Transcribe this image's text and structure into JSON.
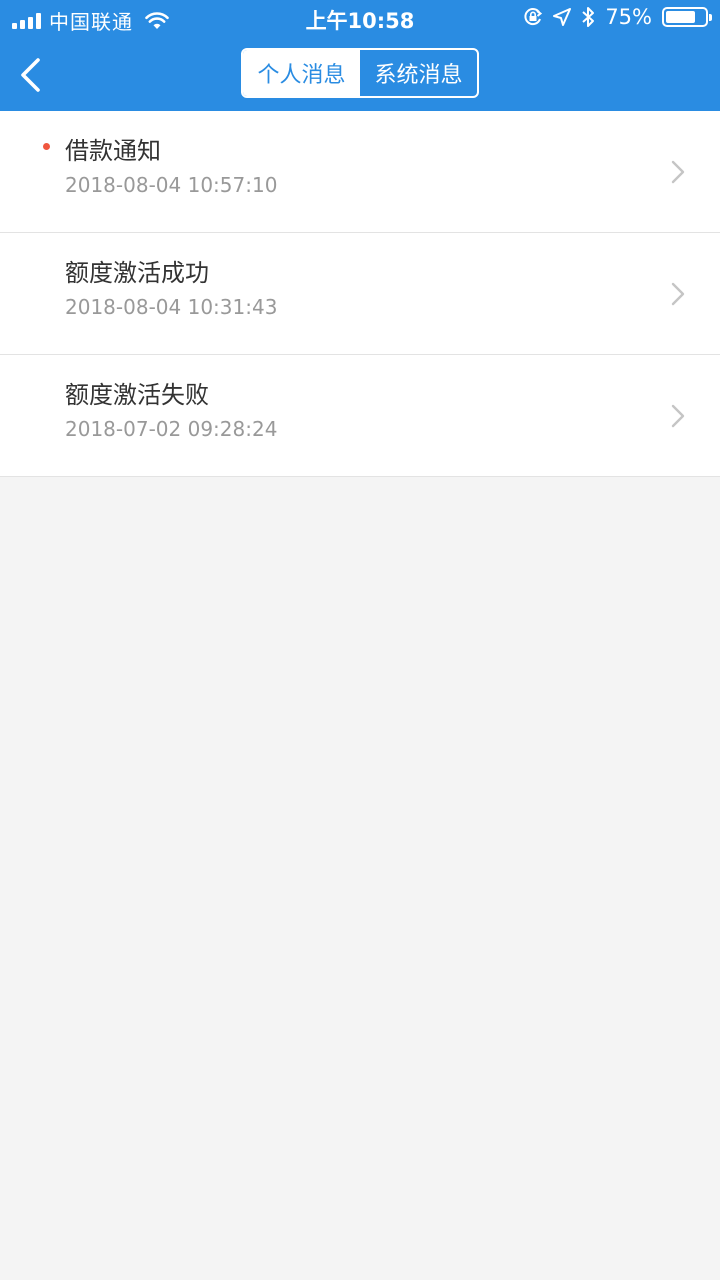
{
  "status_bar": {
    "carrier": "中国联通",
    "time": "上午10:58",
    "battery_percent": "75%",
    "battery_level": 0.75
  },
  "nav": {
    "tabs": [
      {
        "label": "个人消息",
        "active": true
      },
      {
        "label": "系统消息",
        "active": false
      }
    ]
  },
  "messages": [
    {
      "title": "借款通知",
      "time": "2018-08-04 10:57:10",
      "unread": true
    },
    {
      "title": "额度激活成功",
      "time": "2018-08-04 10:31:43",
      "unread": false
    },
    {
      "title": "额度激活失败",
      "time": "2018-07-02 09:28:24",
      "unread": false
    }
  ],
  "colors": {
    "brand_blue": "#2a8ce2",
    "unread_dot": "#f0563f",
    "background": "#f4f4f4"
  },
  "icons": [
    "signal-icon",
    "wifi-icon",
    "orientation-lock-icon",
    "location-icon",
    "bluetooth-icon",
    "battery-icon",
    "back-arrow-icon",
    "chevron-right-icon"
  ]
}
